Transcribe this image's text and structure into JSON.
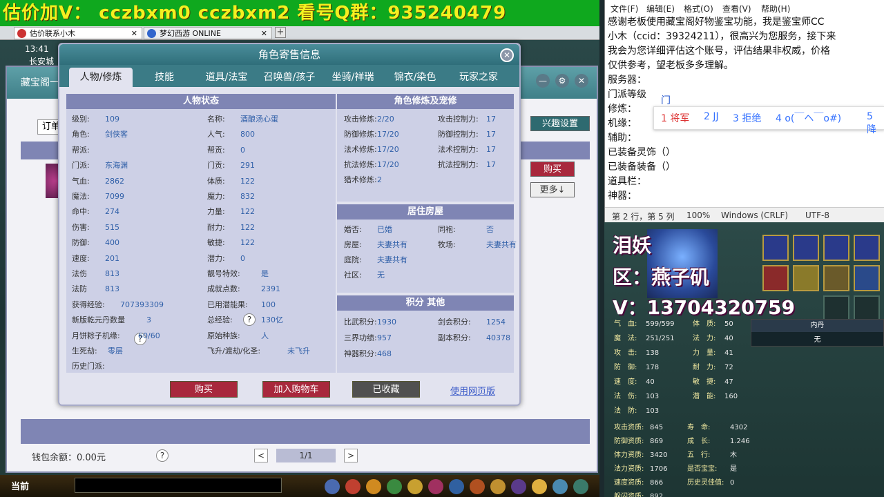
{
  "banner": "估价加V：  cczbxm0   cczbxm2   看号Q群：935240479",
  "browser_tabs": [
    {
      "label": "估价联系小木",
      "close": "✕"
    },
    {
      "label": "梦幻西游 ONLINE",
      "close": "✕"
    }
  ],
  "newtab": "+",
  "game_left": {
    "time": "13:41",
    "location": "长安城",
    "panel_label": "藏宝阁一",
    "order_label": "订单",
    "interest_btn": "兴趣设置",
    "buy_btn": "购买",
    "more_btn": "更多↓",
    "wallet": "钱包余额：0.00元",
    "help": "?",
    "pager": {
      "prev": "<",
      "page": "1/1",
      "next": ">"
    },
    "bottom_label": "当前"
  },
  "modal": {
    "title": "角色寄售信息",
    "close": "✕",
    "tabs": [
      "人物/修炼",
      "技能",
      "道具/法宝",
      "召唤兽/孩子",
      "坐骑/祥瑞",
      "锦衣/染色",
      "玩家之家"
    ],
    "status_title": "人物状态",
    "left_col": [
      {
        "k": "级别:",
        "v": "109"
      },
      {
        "k": "角色:",
        "v": "剑侠客"
      },
      {
        "k": "帮派:",
        "v": ""
      },
      {
        "k": "门派:",
        "v": "东海渊"
      },
      {
        "k": "气血:",
        "v": "2862"
      },
      {
        "k": "魔法:",
        "v": "7099"
      },
      {
        "k": "命中:",
        "v": "274"
      },
      {
        "k": "伤害:",
        "v": "515"
      },
      {
        "k": "防御:",
        "v": "400"
      },
      {
        "k": "速度:",
        "v": "201"
      },
      {
        "k": "法伤",
        "v": "813"
      },
      {
        "k": "法防",
        "v": "813"
      },
      {
        "k": "获得经验:",
        "v": "707393309"
      },
      {
        "k": "新版乾元丹数量",
        "v": "3"
      },
      {
        "k": "月饼粽子机缘:",
        "v": "60/60"
      },
      {
        "k": "生死劫:",
        "v": "零层"
      },
      {
        "k": "历史门派:",
        "v": ""
      }
    ],
    "mid_col": [
      {
        "k": "名称:",
        "v": "酒酿汤心蛋"
      },
      {
        "k": "人气:",
        "v": "800"
      },
      {
        "k": "帮贡:",
        "v": "0"
      },
      {
        "k": "门贡:",
        "v": "291"
      },
      {
        "k": "体质:",
        "v": "122"
      },
      {
        "k": "魔力:",
        "v": "832"
      },
      {
        "k": "力量:",
        "v": "122"
      },
      {
        "k": "耐力:",
        "v": "122"
      },
      {
        "k": "敏捷:",
        "v": "122"
      },
      {
        "k": "潜力:",
        "v": "0"
      },
      {
        "k": "靓号特效:",
        "v": "是"
      },
      {
        "k": "成就点数:",
        "v": "2391"
      },
      {
        "k": "已用潜能果:",
        "v": "100"
      },
      {
        "k": "总经验:",
        "v": "130亿"
      },
      {
        "k": "原始种族:",
        "v": "人"
      },
      {
        "k": "飞升/渡劫/化圣:",
        "v": "未飞升"
      }
    ],
    "cultivation_title": "角色修炼及宠修",
    "cultivation": [
      {
        "k": "攻击修炼:",
        "v": "2/20",
        "k2": "攻击控制力:",
        "v2": "17"
      },
      {
        "k": "防御修炼:",
        "v": "17/20",
        "k2": "防御控制力:",
        "v2": "17"
      },
      {
        "k": "法术修炼:",
        "v": "17/20",
        "k2": "法术控制力:",
        "v2": "17"
      },
      {
        "k": "抗法修炼:",
        "v": "17/20",
        "k2": "抗法控制力:",
        "v2": "17"
      },
      {
        "k": "猎术修炼:",
        "v": "2",
        "k2": "",
        "v2": ""
      }
    ],
    "house_title": "居住房屋",
    "house": [
      {
        "k": "婚否:",
        "v": "已婚",
        "k2": "同袍:",
        "v2": "否"
      },
      {
        "k": "房屋:",
        "v": "夫妻共有",
        "k2": "牧场:",
        "v2": "夫妻共有"
      },
      {
        "k": "庭院:",
        "v": "夫妻共有",
        "k2": "",
        "v2": ""
      },
      {
        "k": "社区:",
        "v": "无",
        "k2": "",
        "v2": ""
      }
    ],
    "score_title": "积分 其他",
    "score": [
      {
        "k": "比武积分:",
        "v": "1930",
        "k2": "剑会积分:",
        "v2": "1254"
      },
      {
        "k": "三界功绩:",
        "v": "957",
        "k2": "副本积分:",
        "v2": "40378"
      },
      {
        "k": "神器积分:",
        "v": "468",
        "k2": "",
        "v2": ""
      }
    ],
    "buttons": {
      "buy": "购买",
      "cart": "加入购物车",
      "fav": "已收藏",
      "web": "使用网页版"
    }
  },
  "notepad": {
    "menu": [
      "文件(F)",
      "编辑(E)",
      "格式(O)",
      "查看(V)",
      "帮助(H)"
    ],
    "text": "感谢老板使用藏宝阁好物鉴宝功能，我是鉴宝师CC\n小木（ccid：39324211），很高兴为您服务，接下来\n我会为您详细评估这个账号，评估结果非权威，价格\n仅供参考，望老板多多理解。\n服务器：\n门派等级\n修炼：\n机缘：\n辅助：\n已装备灵饰（）\n已装备装备（）\n道具栏：\n神器：",
    "ime_comp": "门",
    "ime_candidates": [
      "1 将军",
      "2 JJ",
      "3 拒绝",
      "4 o(￣ヘ￣o#)",
      "5 降"
    ],
    "status": [
      "第 2 行，第 5 列",
      "100%",
      "Windows (CRLF)",
      "UTF-8"
    ]
  },
  "game_right": {
    "overlay_name": "泪妖",
    "overlay_region": "区：燕子矶",
    "overlay_v": "V：13704320759",
    "equip_title": "内丹",
    "equip_val": "无",
    "stats_top": [
      {
        "k": "气　血:",
        "v": "599/599"
      },
      {
        "k": "魔　法:",
        "v": "251/251"
      },
      {
        "k": "攻　击:",
        "v": "138"
      },
      {
        "k": "防　御:",
        "v": "178"
      },
      {
        "k": "速　度:",
        "v": "40"
      },
      {
        "k": "法　伤:",
        "v": "103"
      },
      {
        "k": "法　防:",
        "v": "103"
      }
    ],
    "stats_top2": [
      {
        "k": "体　质:",
        "v": "50"
      },
      {
        "k": "法　力:",
        "v": "40"
      },
      {
        "k": "力　量:",
        "v": "41"
      },
      {
        "k": "耐　力:",
        "v": "72"
      },
      {
        "k": "敏　捷:",
        "v": "47"
      },
      {
        "k": "潜　能:",
        "v": "160"
      }
    ],
    "stats_bottom": [
      {
        "k": "攻击资质:",
        "v": "845"
      },
      {
        "k": "防御资质:",
        "v": "869"
      },
      {
        "k": "体力资质:",
        "v": "3420"
      },
      {
        "k": "法力资质:",
        "v": "1706"
      },
      {
        "k": "速度资质:",
        "v": "866"
      },
      {
        "k": "躲闪资质:",
        "v": "892"
      }
    ],
    "stats_bottom2": [
      {
        "k": "寿　命:",
        "v": "4302"
      },
      {
        "k": "成　长:",
        "v": "1.246"
      },
      {
        "k": "五　行:",
        "v": "木"
      },
      {
        "k": "是否宝宝:",
        "v": "是"
      },
      {
        "k": "历史灵佳值:",
        "v": "0"
      }
    ]
  }
}
